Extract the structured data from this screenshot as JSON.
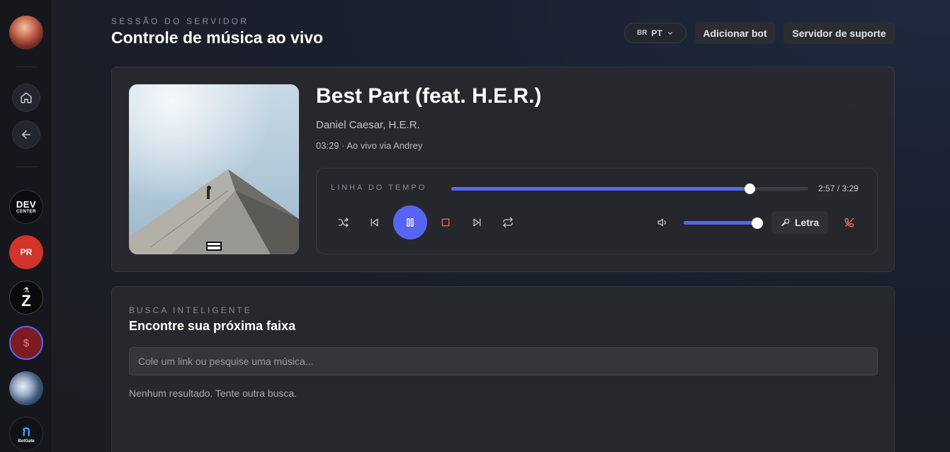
{
  "header": {
    "eyebrow": "SESSÃO DO SERVIDOR",
    "title": "Controle de música ao vivo",
    "language": {
      "flag": "BR",
      "code": "PT"
    },
    "add_bot_label": "Adicionar bot",
    "support_label": "Servidor de suporte"
  },
  "sidebar": {
    "nav": [
      {
        "icon": "home-icon"
      },
      {
        "icon": "arrow-left-icon"
      }
    ],
    "servers": [
      {
        "name": "dev-center",
        "line1": "DEV",
        "line2": "CENTER"
      },
      {
        "name": "pr",
        "label": "PR",
        "color": "#d0342a"
      },
      {
        "name": "z",
        "label": "Z"
      },
      {
        "name": "dollar",
        "label": "$",
        "color": "#7c1c20"
      },
      {
        "name": "cloud"
      },
      {
        "name": "botgate",
        "line2": "BotGate"
      }
    ]
  },
  "player": {
    "title": "Best Part (feat. H.E.R.)",
    "artist": "Daniel Caesar, H.E.R.",
    "meta": "03:29 · Ao vivo via Andrey",
    "timeline_label": "LINHA DO TEMPO",
    "time": "2:57 / 3:29",
    "progress_fraction": 0.835,
    "volume_fraction": 1.0,
    "is_playing": true,
    "lyrics_label": "Letra",
    "accent": "#5865f2",
    "stop_color": "#e8704a",
    "hangup_color": "#e8704a",
    "cover_advisory": "PARENTAL ADVISORY"
  },
  "search": {
    "eyebrow": "BUSCA INTELIGENTE",
    "title": "Encontre sua próxima faixa",
    "placeholder": "Cole um link ou pesquise uma música...",
    "empty_text": "Nenhum resultado. Tente outra busca."
  }
}
